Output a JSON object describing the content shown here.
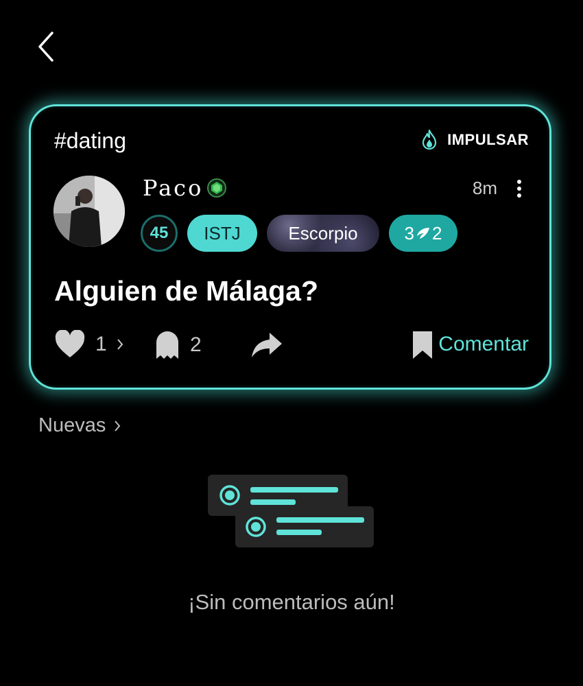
{
  "post": {
    "hashtag": "#dating",
    "boost_label": "IMPULSAR",
    "username": "Paco",
    "time_ago": "8m",
    "age": "45",
    "mbti": "ISTJ",
    "zodiac": "Escorpio",
    "enneagram_left": "3",
    "enneagram_right": "2",
    "title": "Alguien de Málaga?",
    "likes_count": "1",
    "ghost_count": "2",
    "comment_label": "Comentar"
  },
  "comments": {
    "sort_label": "Nuevas",
    "empty_text": "¡Sin comentarios aún!"
  },
  "colors": {
    "accent": "#5fe3d9",
    "background": "#000000",
    "muted_text": "#bdbdbd"
  }
}
